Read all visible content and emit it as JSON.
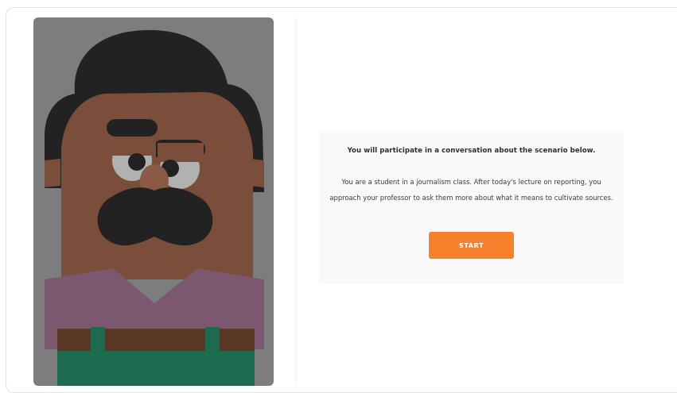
{
  "scenario": {
    "heading": "You will participate in a conversation about the scenario below.",
    "description": "You are a student in a journalism class. After today's lecture on reporting, you approach your professor to ask them more about what it means to cultivate sources.",
    "start_label": "START"
  },
  "colors": {
    "accent": "#f5812d",
    "portrait_background": "#7d7d7d",
    "skin": "#7a4e3a",
    "hair": "#222222",
    "shirt": "#7b5870",
    "belt": "#5b3826",
    "pants": "#1f6b50"
  },
  "icons": {
    "portrait": "character-portrait"
  }
}
